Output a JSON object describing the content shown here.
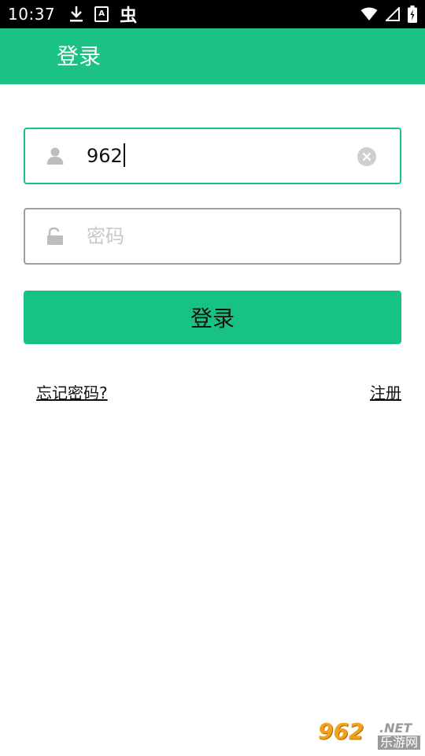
{
  "status_bar": {
    "time": "10:37",
    "left_icons": [
      "download-icon",
      "a-notification-icon",
      "bug-icon"
    ],
    "right_icons": [
      "wifi-icon",
      "signal-icon",
      "battery-icon"
    ],
    "a_icon_glyph": "A",
    "bug_glyph": "虫"
  },
  "app_bar": {
    "title": "登录",
    "color": "#1bc283"
  },
  "form": {
    "username": {
      "value": "962",
      "icon": "user-icon",
      "clear_icon": "clear-icon"
    },
    "password": {
      "placeholder": "密码",
      "icon": "lock-icon"
    },
    "login_label": "登录"
  },
  "links": {
    "forgot_password": "忘记密码?",
    "register": "注册"
  },
  "watermark": {
    "number": "962",
    "suffix": ".NET",
    "site_name": "乐游网"
  }
}
